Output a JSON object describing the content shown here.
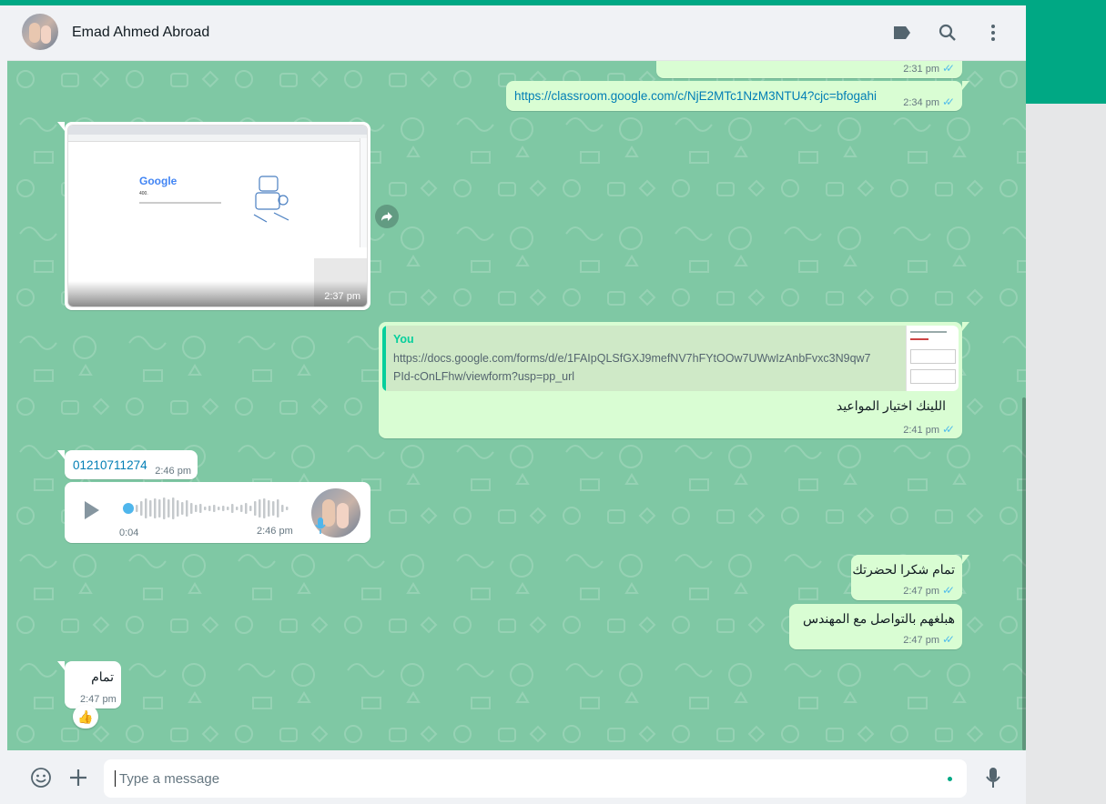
{
  "header": {
    "contact_name": "Emad Ahmed Abroad",
    "icons": [
      "label-icon",
      "search-icon",
      "menu-icon"
    ]
  },
  "messages": {
    "m1": {
      "time": "2:31 pm"
    },
    "m2": {
      "text": "https://classroom.google.com/c/NjE2MTc1NzM3NTU4?cjc=bfogahi",
      "time": "2:34 pm"
    },
    "m3": {
      "time": "2:37 pm",
      "thumb_title": "Google",
      "thumb_code": "400."
    },
    "m4": {
      "quote_author": "You",
      "quote_text_line1": "https://docs.google.com/forms/d/e/1FAIpQLSfGXJ9mefNV7hFYtOOw7UWwIzAnbFvxc3N9qw7",
      "quote_text_line2": "PId-cOnLFhw/viewform?usp=pp_url",
      "text": "اللينك اختيار المواعيد",
      "time": "2:41 pm"
    },
    "m5": {
      "text": "01210711274",
      "time": "2:46 pm"
    },
    "m6": {
      "duration": "0:04",
      "time": "2:46 pm"
    },
    "m7": {
      "text": "تمام شكرا لحضرتك",
      "time": "2:47 pm"
    },
    "m8": {
      "text": "هبلغهم بالتواصل مع المهندس",
      "time": "2:47 pm"
    },
    "m9": {
      "text": "تمام",
      "time": "2:47 pm",
      "reaction": "👍"
    }
  },
  "footer": {
    "placeholder": "Type a message"
  },
  "colors": {
    "accent": "#00a884",
    "outgoing_bubble": "#d9fdd3",
    "incoming_bubble": "#ffffff",
    "chat_background": "#7fc8a4",
    "read_ticks": "#53bdeb",
    "link": "#027eb5"
  }
}
